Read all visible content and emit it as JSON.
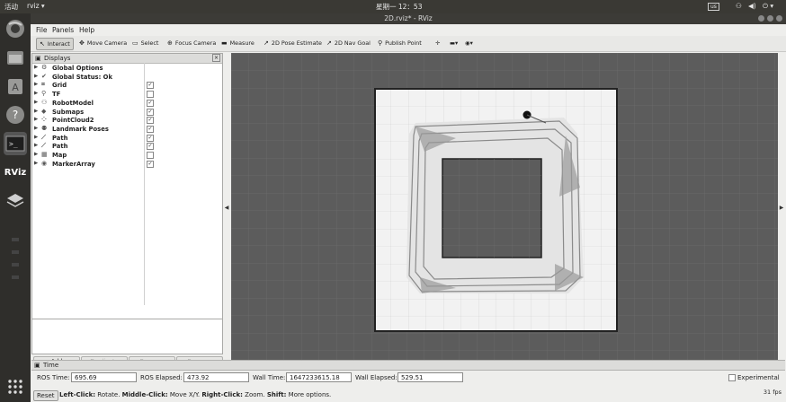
{
  "system_bar": {
    "activities": "活动",
    "app_menu": "rviz ▾",
    "clock": "星期一 12：53",
    "keyboard": "us"
  },
  "launcher": {
    "items": [
      {
        "name": "browser-icon"
      },
      {
        "name": "files-icon"
      },
      {
        "name": "software-center-icon"
      },
      {
        "name": "help-icon"
      },
      {
        "name": "terminal-icon"
      },
      {
        "name": "rviz-icon",
        "label": "RViz"
      },
      {
        "name": "layers-icon"
      }
    ]
  },
  "window": {
    "title": "2D.rviz* - RViz"
  },
  "menu": {
    "file": "File",
    "panels": "Panels",
    "help": "Help"
  },
  "toolbar": {
    "interact": "Interact",
    "move_camera": "Move Camera",
    "select": "Select",
    "focus_camera": "Focus Camera",
    "measure": "Measure",
    "pose_estimate": "2D Pose Estimate",
    "nav_goal": "2D Nav Goal",
    "publish_point": "Publish Point"
  },
  "displays": {
    "header": "Displays",
    "items": [
      {
        "label": "Global Options",
        "check": null
      },
      {
        "label": "Global Status: Ok",
        "check": null
      },
      {
        "label": "Grid",
        "check": true
      },
      {
        "label": "TF",
        "check": false
      },
      {
        "label": "RobotModel",
        "check": true
      },
      {
        "label": "Submaps",
        "check": true
      },
      {
        "label": "PointCloud2",
        "check": true
      },
      {
        "label": "Landmark Poses",
        "check": true
      },
      {
        "label": "Path",
        "check": true
      },
      {
        "label": "Path",
        "check": true
      },
      {
        "label": "Map",
        "check": false
      },
      {
        "label": "MarkerArray",
        "check": true
      }
    ],
    "buttons": {
      "add": "Add",
      "duplicate": "Duplicate",
      "remove": "Remove",
      "rename": "Rename"
    }
  },
  "time": {
    "header": "Time",
    "ros_time_label": "ROS Time:",
    "ros_time": "695.69",
    "ros_elapsed_label": "ROS Elapsed:",
    "ros_elapsed": "473.92",
    "wall_time_label": "Wall Time:",
    "wall_time": "1647233615.18",
    "wall_elapsed_label": "Wall Elapsed:",
    "wall_elapsed": "529.51",
    "experimental": "Experimental"
  },
  "status_bar": {
    "reset": "Reset",
    "left_click": "Left-Click:",
    "left_text": "Rotate.",
    "middle_click": "Middle-Click:",
    "middle_text": "Move X/Y.",
    "right_click": "Right-Click:",
    "right_text": "Zoom.",
    "shift": "Shift:",
    "shift_text": "More options.",
    "fps": "31 fps"
  }
}
